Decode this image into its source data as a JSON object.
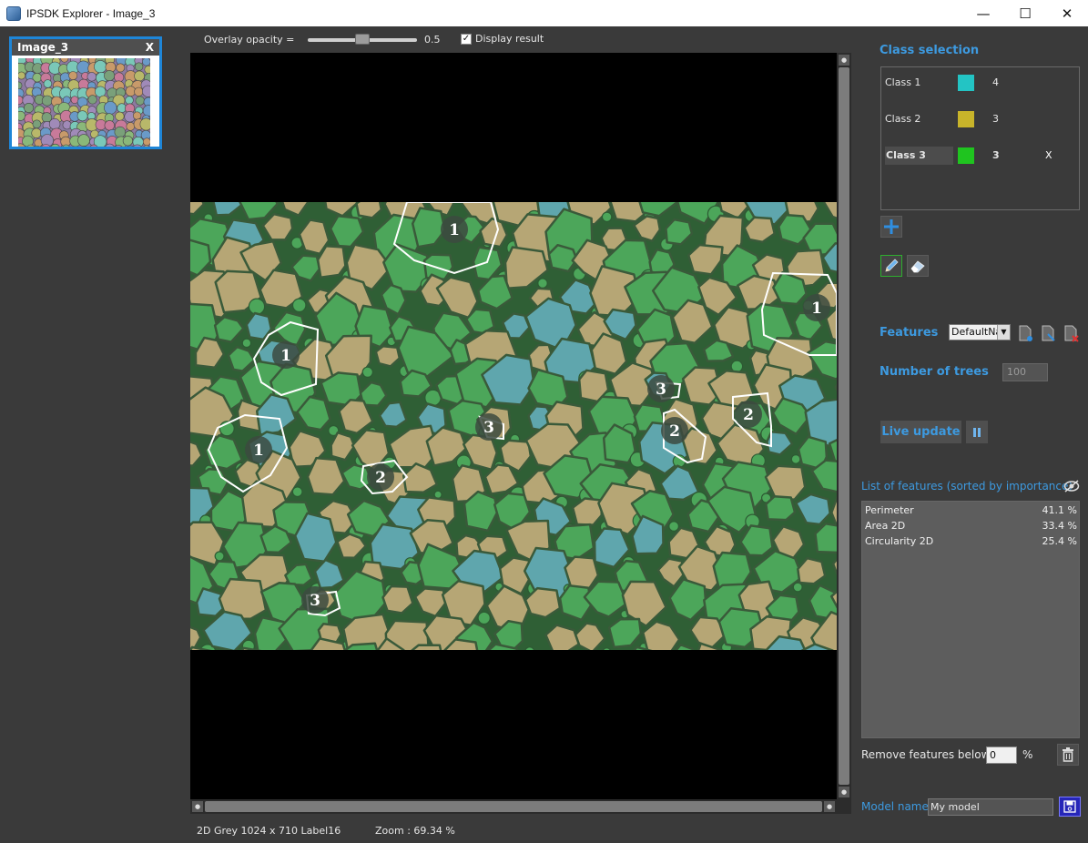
{
  "window": {
    "title": "IPSDK Explorer - Image_3",
    "minimize": "—",
    "maximize": "☐",
    "close": "✕"
  },
  "thumbnail": {
    "title": "Image_3",
    "close": "X"
  },
  "toolbar": {
    "overlay_label": "Overlay opacity =",
    "overlay_value": "0.5",
    "overlay_fraction": 0.5,
    "display_result_label": "Display result",
    "display_result_checked": true
  },
  "annotations": [
    "1",
    "1",
    "1",
    "1",
    "2",
    "2",
    "2",
    "3",
    "3",
    "3"
  ],
  "status": {
    "image_info": "2D Grey 1024 x 710 Label16",
    "zoom": "Zoom : 69.34 %"
  },
  "class_selection": {
    "title": "Class selection",
    "classes": [
      {
        "name": "Class 1",
        "color": "#23c4c4",
        "count": "4",
        "selected": false
      },
      {
        "name": "Class 2",
        "color": "#c8b42a",
        "count": "3",
        "selected": false
      },
      {
        "name": "Class 3",
        "color": "#1fc41f",
        "count": "3",
        "selected": true,
        "delete": "X"
      }
    ]
  },
  "features": {
    "label": "Features",
    "selected": "DefaultName"
  },
  "trees": {
    "label": "Number of trees",
    "value": "100"
  },
  "live_update": {
    "label": "Live update"
  },
  "feature_list": {
    "title": "List of features (sorted by importance)",
    "items": [
      {
        "name": "Perimeter",
        "value": "41.1 %"
      },
      {
        "name": "Area 2D",
        "value": "33.4 %"
      },
      {
        "name": "Circularity 2D",
        "value": "25.4 %"
      }
    ]
  },
  "remove_features": {
    "label": "Remove features below",
    "value": "0",
    "unit": "%"
  },
  "model": {
    "label": "Model name",
    "value": "My model"
  },
  "colors": {
    "accent": "#3d9ae0",
    "cell_blue": "#5fa6ad",
    "cell_tan": "#b6a675",
    "cell_green": "#4ca65a"
  }
}
